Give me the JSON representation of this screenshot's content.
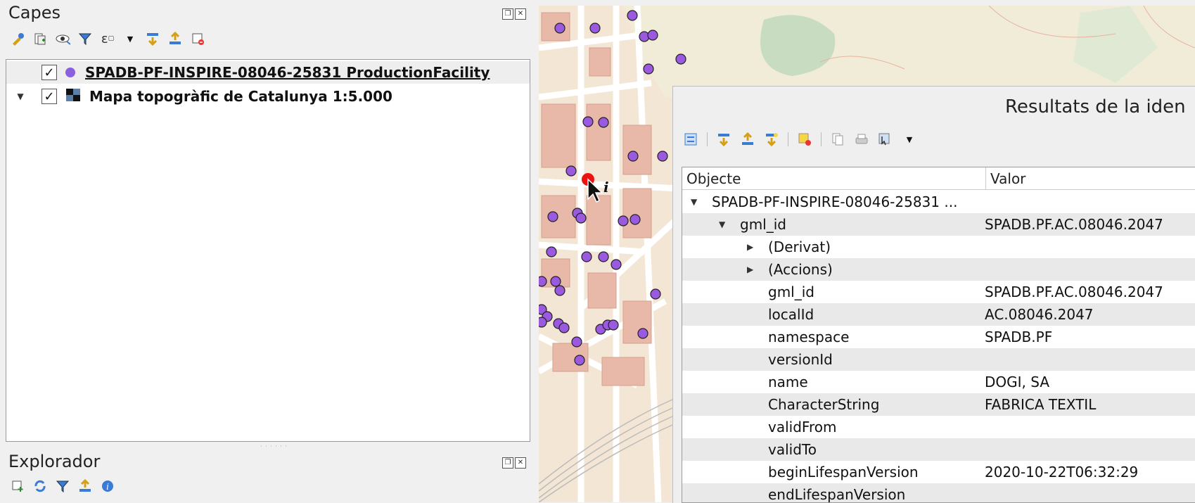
{
  "layers_panel": {
    "title": "Capes",
    "toolbar_icons": [
      "style-manager-icon",
      "add-group-icon",
      "visibility-icon",
      "filter-icon",
      "expression-filter-icon",
      "dropdown-arrow-icon",
      "expand-all-icon",
      "collapse-all-icon",
      "remove-layer-icon"
    ],
    "layers": [
      {
        "name": "SPADB-PF-INSPIRE-08046-25831 ProductionFacility",
        "checked": true,
        "icon": "point-layer-icon",
        "expandable": false
      },
      {
        "name": "Mapa topogràfic de Catalunya 1:5.000",
        "checked": true,
        "icon": "raster-layer-icon",
        "expandable": true
      }
    ]
  },
  "browser_panel": {
    "title": "Explorador",
    "toolbar_icons": [
      "add-selected-icon",
      "refresh-icon",
      "filter-icon",
      "collapse-all-icon",
      "info-icon"
    ]
  },
  "identify": {
    "title": "Resultats de la iden",
    "toolbar_icons": [
      "expand-tree-icon",
      "expand-all-icon",
      "collapse-all-icon",
      "expand-new-icon",
      "clear-highlight-icon",
      "copy-icon",
      "print-icon",
      "identify-mode-icon",
      "dropdown-arrow-icon"
    ],
    "columns": [
      "Objecte",
      "Valor"
    ],
    "rows": [
      {
        "indent": 0,
        "arrow": "down",
        "feature": "SPADB-PF-INSPIRE-08046-25831 ...",
        "value": ""
      },
      {
        "indent": 1,
        "arrow": "down",
        "feature": "gml_id",
        "value": "SPADB.PF.AC.08046.2047"
      },
      {
        "indent": 2,
        "arrow": "right",
        "feature": "(Derivat)",
        "value": ""
      },
      {
        "indent": 2,
        "arrow": "right",
        "feature": "(Accions)",
        "value": ""
      },
      {
        "indent": 2,
        "arrow": "",
        "feature": "gml_id",
        "value": "SPADB.PF.AC.08046.2047"
      },
      {
        "indent": 2,
        "arrow": "",
        "feature": "localId",
        "value": "AC.08046.2047"
      },
      {
        "indent": 2,
        "arrow": "",
        "feature": "namespace",
        "value": "SPADB.PF"
      },
      {
        "indent": 2,
        "arrow": "",
        "feature": "versionId",
        "value": ""
      },
      {
        "indent": 2,
        "arrow": "",
        "feature": "name",
        "value": "DOGI, SA"
      },
      {
        "indent": 2,
        "arrow": "",
        "feature": "CharacterString",
        "value": "FABRICA TEXTIL"
      },
      {
        "indent": 2,
        "arrow": "",
        "feature": "validFrom",
        "value": ""
      },
      {
        "indent": 2,
        "arrow": "",
        "feature": "validTo",
        "value": ""
      },
      {
        "indent": 2,
        "arrow": "",
        "feature": "beginLifespanVersion",
        "value": "2020-10-22T06:32:29"
      },
      {
        "indent": 2,
        "arrow": "",
        "feature": "endLifespanVersion",
        "value": ""
      }
    ]
  },
  "map": {
    "point_color": "#9b59e0",
    "highlight_color": "#ee1111",
    "building_color": "#e8b9a8",
    "road_color": "#ffffff",
    "green_color": "#c7dcc0"
  }
}
